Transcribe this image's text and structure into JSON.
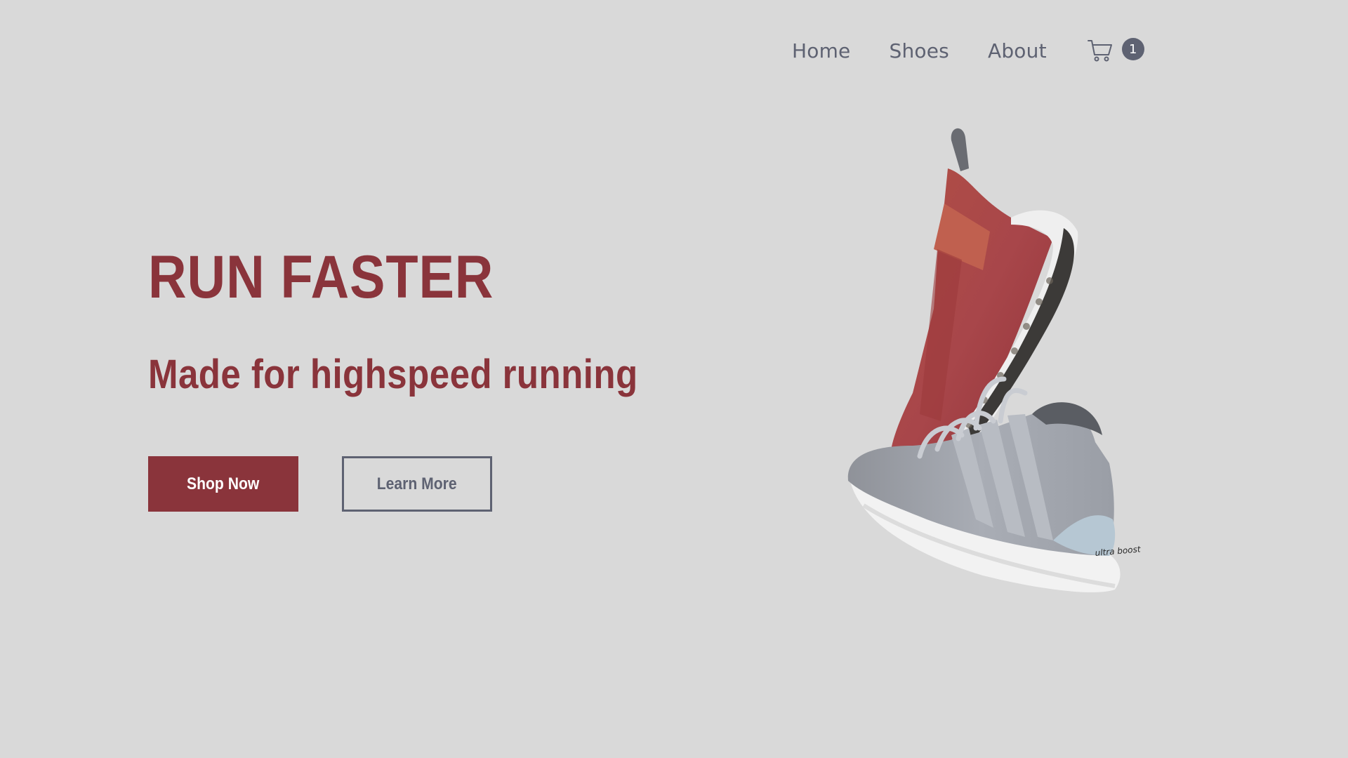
{
  "nav": {
    "links": [
      {
        "label": "Home"
      },
      {
        "label": "Shoes"
      },
      {
        "label": "About"
      }
    ],
    "cart": {
      "icon": "shopping-cart-icon",
      "count": "1"
    }
  },
  "hero": {
    "title": "RUN FASTER",
    "subtitle": "Made for highspeed running",
    "primary_button": "Shop Now",
    "secondary_button": "Learn More",
    "image": {
      "brand_text": "ultra boost"
    }
  },
  "colors": {
    "background": "#d9d9d9",
    "accent": "#8a343b",
    "nav_text": "#5e6272",
    "button_text_light": "#ffffff"
  }
}
